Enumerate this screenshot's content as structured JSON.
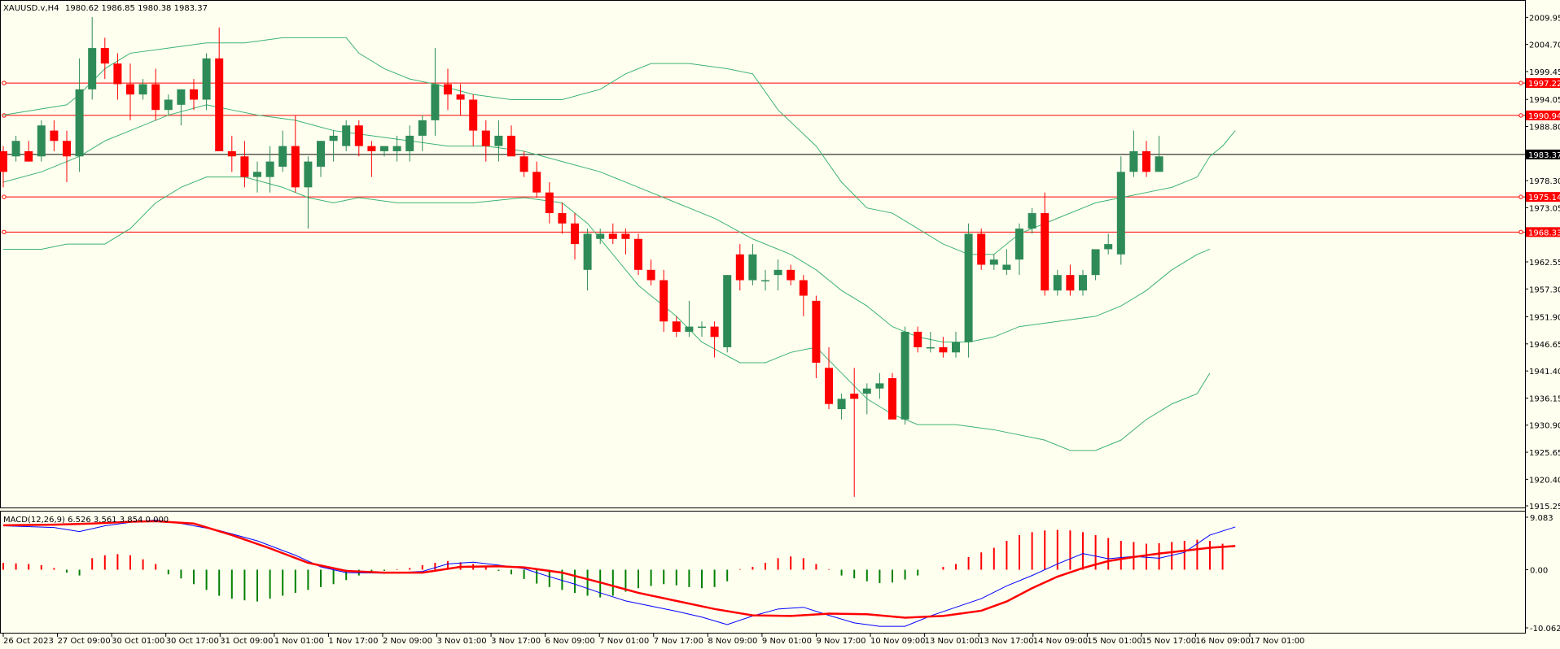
{
  "colors": {
    "background": "#fffff0",
    "bull": "#2e8b57",
    "bear": "#ff0000",
    "band": "#3cb371",
    "level": "#ff0000",
    "current": "#000000",
    "macd_line": "#0000ff",
    "signal_line": "#ff0000",
    "hist_pos": "#ff0000",
    "hist_neg": "#008000"
  },
  "header": {
    "symbol_timeframe": "XAUUSD.v,H4",
    "ohlc": "1980.62 1986.85 1980.38 1983.37"
  },
  "macd": {
    "label": "MACD(12,26,9) 6.526 3.561 3.854 0.000",
    "axis_labels": [
      "9.083",
      "0.00",
      "-10.062"
    ]
  },
  "price_axis": {
    "labels": [
      "2009.95",
      "2004.70",
      "1999.45",
      "1994.05",
      "1988.80",
      "1978.30",
      "1973.05",
      "1962.55",
      "1957.30",
      "1951.90",
      "1946.65",
      "1941.40",
      "1936.15",
      "1930.90",
      "1925.65",
      "1920.40",
      "1915.25"
    ]
  },
  "time_axis": {
    "labels": [
      "26 Oct 2023",
      "27 Oct 09:00",
      "30 Oct 01:00",
      "30 Oct 17:00",
      "31 Oct 09:00",
      "1 Nov 01:00",
      "1 Nov 17:00",
      "2 Nov 09:00",
      "3 Nov 01:00",
      "3 Nov 17:00",
      "6 Nov 09:00",
      "7 Nov 01:00",
      "7 Nov 17:00",
      "8 Nov 09:00",
      "9 Nov 01:00",
      "9 Nov 17:00",
      "10 Nov 09:00",
      "13 Nov 01:00",
      "13 Nov 17:00",
      "14 Nov 09:00",
      "15 Nov 01:00",
      "15 Nov 17:00",
      "16 Nov 09:00",
      "17 Nov 01:00"
    ]
  },
  "chart_data": {
    "type": "candlestick",
    "ylim": [
      1915.25,
      2013.0
    ],
    "levels": [
      {
        "value": 1997.22,
        "label": "1997.22"
      },
      {
        "value": 1990.94,
        "label": "1990.94"
      },
      {
        "value": 1975.14,
        "label": "1975.14"
      },
      {
        "value": 1968.33,
        "label": "1968.33"
      }
    ],
    "current_price": {
      "value": 1983.37,
      "label": "1983.37"
    },
    "candles": [
      [
        1984,
        1985,
        1977,
        1980
      ],
      [
        1983,
        1987,
        1982,
        1986
      ],
      [
        1984,
        1986,
        1982,
        1982
      ],
      [
        1983,
        1990,
        1982,
        1989
      ],
      [
        1988,
        1990,
        1984,
        1986
      ],
      [
        1986,
        1988,
        1978,
        1983
      ],
      [
        1983,
        2002,
        1980,
        1996
      ],
      [
        1996,
        2010,
        1994,
        2004
      ],
      [
        2004,
        2006,
        1998,
        2001
      ],
      [
        2001,
        2003,
        1994,
        1997
      ],
      [
        1997,
        2001,
        1990,
        1995
      ],
      [
        1995,
        1998,
        1994,
        1997
      ],
      [
        1997,
        2000,
        1990,
        1992
      ],
      [
        1992,
        1995,
        1991,
        1994
      ],
      [
        1993,
        1996,
        1989,
        1996
      ],
      [
        1996,
        1998,
        1992,
        1994
      ],
      [
        1994,
        2003,
        1992,
        2002
      ],
      [
        2002,
        2008,
        1984,
        1984
      ],
      [
        1984,
        1987,
        1980,
        1983
      ],
      [
        1983,
        1986,
        1977,
        1979
      ],
      [
        1979,
        1982,
        1976,
        1980
      ],
      [
        1979,
        1985,
        1976,
        1982
      ],
      [
        1981,
        1988,
        1980,
        1985
      ],
      [
        1985,
        1991,
        1976,
        1977
      ],
      [
        1977,
        1983,
        1969,
        1982
      ],
      [
        1981,
        1986,
        1979,
        1986
      ],
      [
        1986,
        1988,
        1982,
        1987
      ],
      [
        1985,
        1990,
        1984,
        1989
      ],
      [
        1989,
        1990,
        1983,
        1985
      ],
      [
        1985,
        1986,
        1979,
        1984
      ],
      [
        1984,
        1985,
        1983,
        1985
      ],
      [
        1984,
        1987,
        1982,
        1985
      ],
      [
        1984,
        1989,
        1982,
        1987
      ],
      [
        1987,
        1991,
        1984,
        1990
      ],
      [
        1990,
        2004,
        1987,
        1997
      ],
      [
        1997,
        2000,
        1992,
        1995
      ],
      [
        1995,
        1997,
        1991,
        1994
      ],
      [
        1994,
        1995,
        1985,
        1988
      ],
      [
        1988,
        1990,
        1982,
        1985
      ],
      [
        1985,
        1990,
        1982,
        1987
      ],
      [
        1987,
        1989,
        1984,
        1983
      ],
      [
        1983,
        1984,
        1979,
        1980
      ],
      [
        1980,
        1982,
        1975,
        1976
      ],
      [
        1976,
        1978,
        1970,
        1972
      ],
      [
        1972,
        1974,
        1968,
        1970
      ],
      [
        1970,
        1972,
        1963,
        1966
      ],
      [
        1961,
        1969,
        1957,
        1968
      ],
      [
        1967,
        1969,
        1966,
        1968
      ],
      [
        1968,
        1970,
        1966,
        1967
      ],
      [
        1968,
        1969,
        1964,
        1967
      ],
      [
        1967,
        1968,
        1960,
        1961
      ],
      [
        1961,
        1963,
        1958,
        1959
      ],
      [
        1959,
        1961,
        1949,
        1951
      ],
      [
        1951,
        1952,
        1948,
        1949
      ],
      [
        1949,
        1955,
        1948,
        1950
      ],
      [
        1950,
        1951,
        1948,
        1950
      ],
      [
        1950,
        1951,
        1944,
        1948
      ],
      [
        1946,
        1960,
        1945,
        1960
      ],
      [
        1964,
        1966,
        1957,
        1959
      ],
      [
        1959,
        1966,
        1958,
        1964
      ],
      [
        1959,
        1961,
        1957,
        1959
      ],
      [
        1960,
        1963,
        1957,
        1961
      ],
      [
        1961,
        1962,
        1958,
        1959
      ],
      [
        1959,
        1960,
        1952,
        1956
      ],
      [
        1955,
        1956,
        1940,
        1943
      ],
      [
        1942,
        1946,
        1934,
        1935
      ],
      [
        1934,
        1937,
        1932,
        1936
      ],
      [
        1937,
        1942,
        1917,
        1936
      ],
      [
        1937,
        1939,
        1933,
        1938
      ],
      [
        1938,
        1941,
        1936,
        1939
      ],
      [
        1940,
        1941,
        1934,
        1932
      ],
      [
        1932,
        1950,
        1931,
        1949
      ],
      [
        1949,
        1950,
        1945,
        1946
      ],
      [
        1946,
        1949,
        1945,
        1946
      ],
      [
        1946,
        1948,
        1944,
        1945
      ],
      [
        1945,
        1949,
        1944,
        1947
      ],
      [
        1947,
        1970,
        1944,
        1968
      ],
      [
        1968,
        1969,
        1961,
        1962
      ],
      [
        1962,
        1964,
        1961,
        1963
      ],
      [
        1961,
        1965,
        1960,
        1962
      ],
      [
        1963,
        1970,
        1960,
        1969
      ],
      [
        1969,
        1973,
        1968,
        1972
      ],
      [
        1972,
        1976,
        1956,
        1957
      ],
      [
        1957,
        1961,
        1956,
        1960
      ],
      [
        1960,
        1962,
        1956,
        1957
      ],
      [
        1957,
        1961,
        1956,
        1960
      ],
      [
        1960,
        1964,
        1959,
        1965
      ],
      [
        1965,
        1968,
        1964,
        1966
      ],
      [
        1964,
        1983,
        1962,
        1980
      ],
      [
        1980,
        1988,
        1979,
        1984
      ],
      [
        1984,
        1986,
        1979,
        1980
      ],
      [
        1980,
        1987,
        1980,
        1983
      ]
    ],
    "bb_upper": [
      [
        0,
        1991
      ],
      [
        5,
        1993
      ],
      [
        6,
        1995
      ],
      [
        8,
        2000
      ],
      [
        10,
        2003
      ],
      [
        13,
        2004
      ],
      [
        16,
        2005
      ],
      [
        19,
        2005
      ],
      [
        22,
        2006
      ],
      [
        25,
        2006
      ],
      [
        27,
        2006
      ],
      [
        28,
        2003
      ],
      [
        30,
        2000
      ],
      [
        32,
        1998
      ],
      [
        34,
        1997
      ],
      [
        37,
        1995
      ],
      [
        40,
        1994
      ],
      [
        44,
        1994
      ],
      [
        47,
        1996
      ],
      [
        49,
        1999
      ],
      [
        51,
        2001
      ],
      [
        54,
        2001
      ],
      [
        57,
        2000
      ],
      [
        59,
        1999
      ],
      [
        61,
        1992
      ],
      [
        64,
        1985
      ],
      [
        66,
        1978
      ],
      [
        68,
        1973
      ],
      [
        70,
        1972
      ],
      [
        72,
        1969
      ],
      [
        74,
        1966
      ],
      [
        76,
        1964
      ],
      [
        78,
        1964
      ],
      [
        80,
        1968
      ],
      [
        83,
        1971
      ],
      [
        86,
        1974
      ],
      [
        88,
        1975
      ],
      [
        90,
        1976
      ],
      [
        92,
        1977
      ],
      [
        94,
        1979
      ],
      [
        95,
        1983
      ],
      [
        96,
        1985
      ],
      [
        97,
        1988
      ]
    ],
    "bb_middle": [
      [
        0,
        1978
      ],
      [
        3,
        1980
      ],
      [
        6,
        1983
      ],
      [
        8,
        1986
      ],
      [
        10,
        1988
      ],
      [
        13,
        1991
      ],
      [
        16,
        1993
      ],
      [
        18,
        1992
      ],
      [
        20,
        1991
      ],
      [
        23,
        1990
      ],
      [
        26,
        1988
      ],
      [
        29,
        1987
      ],
      [
        32,
        1986
      ],
      [
        35,
        1985
      ],
      [
        38,
        1985
      ],
      [
        41,
        1984
      ],
      [
        44,
        1982
      ],
      [
        47,
        1980
      ],
      [
        50,
        1977
      ],
      [
        53,
        1974
      ],
      [
        56,
        1971
      ],
      [
        59,
        1967
      ],
      [
        62,
        1964
      ],
      [
        64,
        1961
      ],
      [
        66,
        1957
      ],
      [
        68,
        1954
      ],
      [
        70,
        1950
      ],
      [
        72,
        1948
      ],
      [
        74,
        1947
      ],
      [
        76,
        1947
      ],
      [
        78,
        1948
      ],
      [
        80,
        1950
      ],
      [
        83,
        1951
      ],
      [
        86,
        1952
      ],
      [
        88,
        1954
      ],
      [
        90,
        1957
      ],
      [
        92,
        1961
      ],
      [
        94,
        1964
      ],
      [
        95,
        1965
      ]
    ],
    "bb_lower": [
      [
        0,
        1965
      ],
      [
        3,
        1965
      ],
      [
        5,
        1966
      ],
      [
        8,
        1966
      ],
      [
        10,
        1969
      ],
      [
        12,
        1974
      ],
      [
        14,
        1977
      ],
      [
        16,
        1979
      ],
      [
        19,
        1979
      ],
      [
        22,
        1977
      ],
      [
        24,
        1975
      ],
      [
        26,
        1974
      ],
      [
        28,
        1975
      ],
      [
        31,
        1974
      ],
      [
        34,
        1974
      ],
      [
        37,
        1974
      ],
      [
        41,
        1975
      ],
      [
        44,
        1974
      ],
      [
        46,
        1970
      ],
      [
        48,
        1964
      ],
      [
        50,
        1958
      ],
      [
        53,
        1952
      ],
      [
        55,
        1947
      ],
      [
        58,
        1943
      ],
      [
        60,
        1943
      ],
      [
        62,
        1945
      ],
      [
        64,
        1946
      ],
      [
        66,
        1941
      ],
      [
        68,
        1936
      ],
      [
        70,
        1933
      ],
      [
        72,
        1931
      ],
      [
        75,
        1931
      ],
      [
        78,
        1930
      ],
      [
        82,
        1928
      ],
      [
        84,
        1926
      ],
      [
        86,
        1926
      ],
      [
        88,
        1928
      ],
      [
        90,
        1932
      ],
      [
        92,
        1935
      ],
      [
        94,
        1937
      ],
      [
        95,
        1941
      ]
    ],
    "macd": {
      "ylim": [
        -10.062,
        9.083
      ],
      "histogram": [
        1.2,
        1.1,
        1.0,
        0.8,
        0.3,
        -0.5,
        -1.0,
        2.0,
        2.5,
        2.7,
        2.5,
        1.8,
        1.0,
        -0.8,
        -1.5,
        -2.5,
        -3.5,
        -4.5,
        -5.0,
        -5.3,
        -5.5,
        -5.0,
        -4.5,
        -4.0,
        -3.5,
        -3.0,
        -2.5,
        -1.8,
        -1.0,
        -0.5,
        -0.2,
        0.1,
        0.3,
        0.8,
        1.2,
        1.5,
        1.3,
        1.0,
        0.6,
        -0.2,
        -0.8,
        -1.6,
        -2.4,
        -3.0,
        -3.5,
        -4.0,
        -4.5,
        -4.8,
        -4.5,
        -3.8,
        -3.2,
        -2.8,
        -2.5,
        -2.7,
        -3.0,
        -3.2,
        -3.0,
        -2.0,
        0.1,
        0.5,
        1.2,
        2.0,
        2.3,
        2.0,
        1.0,
        0.1,
        -1.0,
        -1.5,
        -2.0,
        -2.3,
        -2.2,
        -1.7,
        -1.0,
        0.0,
        0.5,
        1.0,
        2.2,
        3.0,
        3.8,
        5.0,
        6.0,
        6.5,
        6.8,
        6.9,
        6.8,
        6.5,
        6.0,
        5.5,
        5.0,
        4.8,
        4.5,
        4.6,
        4.8,
        5.0,
        5.2,
        5.0,
        4.5
      ],
      "macd_line": [
        [
          0,
          7.6
        ],
        [
          4,
          7.3
        ],
        [
          6,
          6.6
        ],
        [
          8,
          7.6
        ],
        [
          10,
          8.2
        ],
        [
          12,
          8.6
        ],
        [
          14,
          8.0
        ],
        [
          17,
          6.8
        ],
        [
          20,
          5.0
        ],
        [
          23,
          2.5
        ],
        [
          25,
          0.5
        ],
        [
          27,
          -0.5
        ],
        [
          30,
          -0.6
        ],
        [
          33,
          -0.3
        ],
        [
          35,
          1.0
        ],
        [
          37,
          1.3
        ],
        [
          39,
          0.8
        ],
        [
          41,
          0.2
        ],
        [
          43,
          -1.2
        ],
        [
          45,
          -2.5
        ],
        [
          47,
          -4.0
        ],
        [
          49,
          -5.4
        ],
        [
          51,
          -6.3
        ],
        [
          53,
          -7.2
        ],
        [
          55,
          -8.2
        ],
        [
          57,
          -9.5
        ],
        [
          59,
          -8.0
        ],
        [
          61,
          -6.8
        ],
        [
          63,
          -6.5
        ],
        [
          65,
          -7.9
        ],
        [
          67,
          -9.2
        ],
        [
          69,
          -9.8
        ],
        [
          71,
          -9.8
        ],
        [
          73,
          -8.0
        ],
        [
          75,
          -6.5
        ],
        [
          77,
          -5.0
        ],
        [
          79,
          -2.8
        ],
        [
          81,
          -1.0
        ],
        [
          83,
          1.0
        ],
        [
          85,
          2.8
        ],
        [
          87,
          1.9
        ],
        [
          89,
          2.3
        ],
        [
          91,
          2.0
        ],
        [
          93,
          3.0
        ],
        [
          95,
          6.0
        ],
        [
          97,
          7.4
        ]
      ],
      "signal_line": [
        [
          0,
          7.7
        ],
        [
          4,
          7.8
        ],
        [
          7,
          8.0
        ],
        [
          10,
          8.3
        ],
        [
          12,
          8.4
        ],
        [
          15,
          8.0
        ],
        [
          18,
          6.0
        ],
        [
          21,
          3.7
        ],
        [
          24,
          1.2
        ],
        [
          27,
          -0.2
        ],
        [
          30,
          -0.5
        ],
        [
          33,
          -0.5
        ],
        [
          36,
          0.5
        ],
        [
          39,
          0.6
        ],
        [
          41,
          0.4
        ],
        [
          44,
          -0.5
        ],
        [
          47,
          -2.2
        ],
        [
          50,
          -4.0
        ],
        [
          53,
          -5.4
        ],
        [
          56,
          -6.8
        ],
        [
          59,
          -7.9
        ],
        [
          62,
          -8.0
        ],
        [
          65,
          -7.6
        ],
        [
          68,
          -7.7
        ],
        [
          71,
          -8.3
        ],
        [
          74,
          -8.0
        ],
        [
          77,
          -7.1
        ],
        [
          79,
          -5.5
        ],
        [
          81,
          -3.2
        ],
        [
          83,
          -1.2
        ],
        [
          85,
          0.3
        ],
        [
          87,
          1.5
        ],
        [
          89,
          2.2
        ],
        [
          91,
          2.8
        ],
        [
          93,
          3.3
        ],
        [
          95,
          3.8
        ],
        [
          97,
          4.1
        ]
      ]
    }
  }
}
